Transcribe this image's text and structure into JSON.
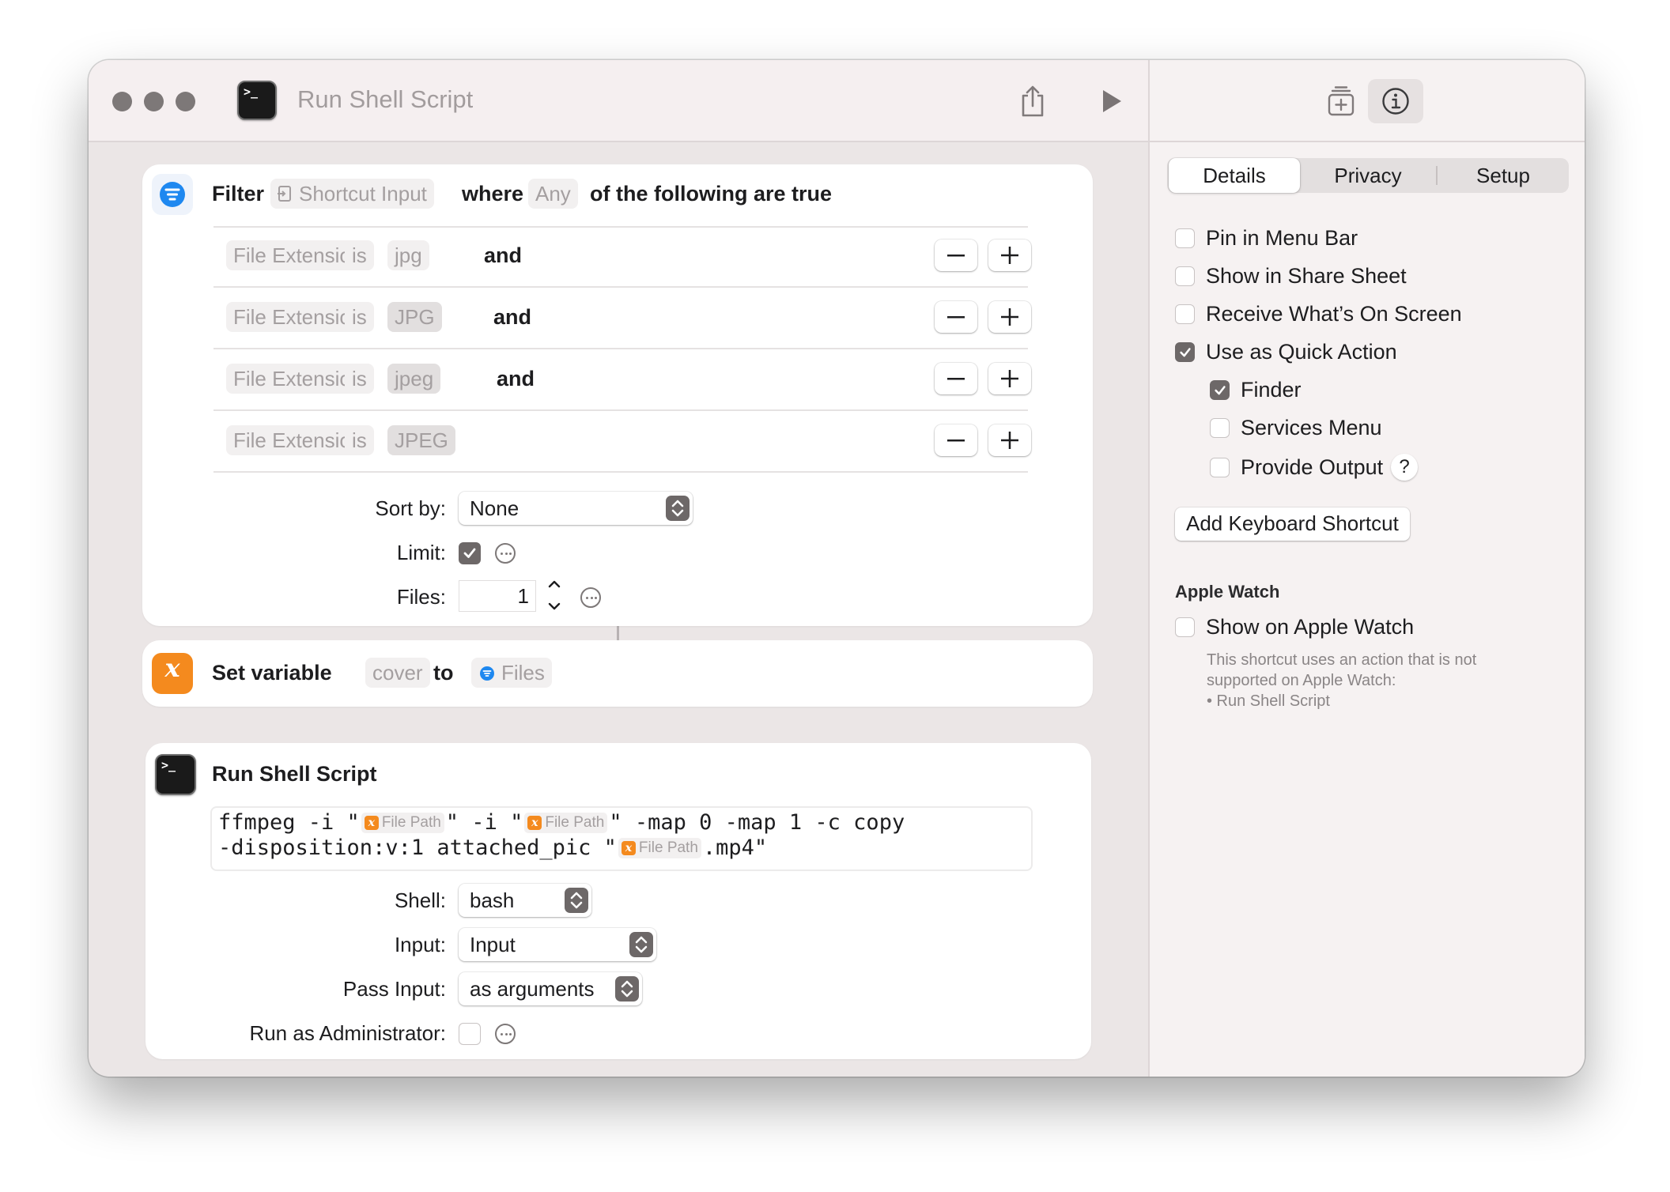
{
  "window": {
    "title": "Run Shell Script"
  },
  "filter": {
    "action": "Filter",
    "input": "Shortcut Input",
    "where": "where",
    "any": "Any",
    "following": "of the following are true",
    "rows": [
      {
        "field": "File Extension",
        "op": "is",
        "value": "jpg",
        "conj": "and"
      },
      {
        "field": "File Extension",
        "op": "is",
        "value": "JPG",
        "conj": "and"
      },
      {
        "field": "File Extension",
        "op": "is",
        "value": "jpeg",
        "conj": "and"
      },
      {
        "field": "File Extension",
        "op": "is",
        "value": "JPEG",
        "conj": ""
      }
    ],
    "sort_label": "Sort by:",
    "sort_value": "None",
    "limit_label": "Limit:",
    "limit_checked": true,
    "files_label": "Files:",
    "files_value": "1"
  },
  "setvar": {
    "action": "Set variable",
    "name": "cover",
    "to": "to",
    "value": "Files"
  },
  "shell": {
    "title": "Run Shell Script",
    "code": {
      "l1a": "ffmpeg -i \"",
      "l1b": "\" -i \"",
      "l1c": "\" -map 0 -map 1 -c copy",
      "l2a": "-disposition:v:1 attached_pic \"",
      "l2b": ".mp4\"",
      "var": "File Path",
      "var_icon": "x"
    },
    "shell_label": "Shell:",
    "shell_value": "bash",
    "input_label": "Input:",
    "input_value": "Input",
    "pass_label": "Pass Input:",
    "pass_value": "as arguments",
    "admin_label": "Run as Administrator:",
    "admin_checked": false
  },
  "sidebar": {
    "tabs": [
      "Details",
      "Privacy",
      "Setup"
    ],
    "active_tab": "Details",
    "options": [
      {
        "label": "Pin in Menu Bar",
        "checked": false
      },
      {
        "label": "Show in Share Sheet",
        "checked": false
      },
      {
        "label": "Receive What’s On Screen",
        "checked": false
      },
      {
        "label": "Use as Quick Action",
        "checked": true
      }
    ],
    "quick_action_options": [
      {
        "label": "Finder",
        "checked": true
      },
      {
        "label": "Services Menu",
        "checked": false
      },
      {
        "label": "Provide Output",
        "checked": false
      }
    ],
    "help": "?",
    "keyboard_button": "Add Keyboard Shortcut",
    "watch_heading": "Apple Watch",
    "watch_option": {
      "label": "Show on Apple Watch",
      "checked": false
    },
    "watch_note": "This shortcut uses an action that is not\nsupported on Apple Watch:\n• Run Shell Script"
  },
  "colors": {
    "accent_gray": "#6d6868",
    "filter_blue": "#1e88f0",
    "variable_orange": "#f48a1e"
  }
}
